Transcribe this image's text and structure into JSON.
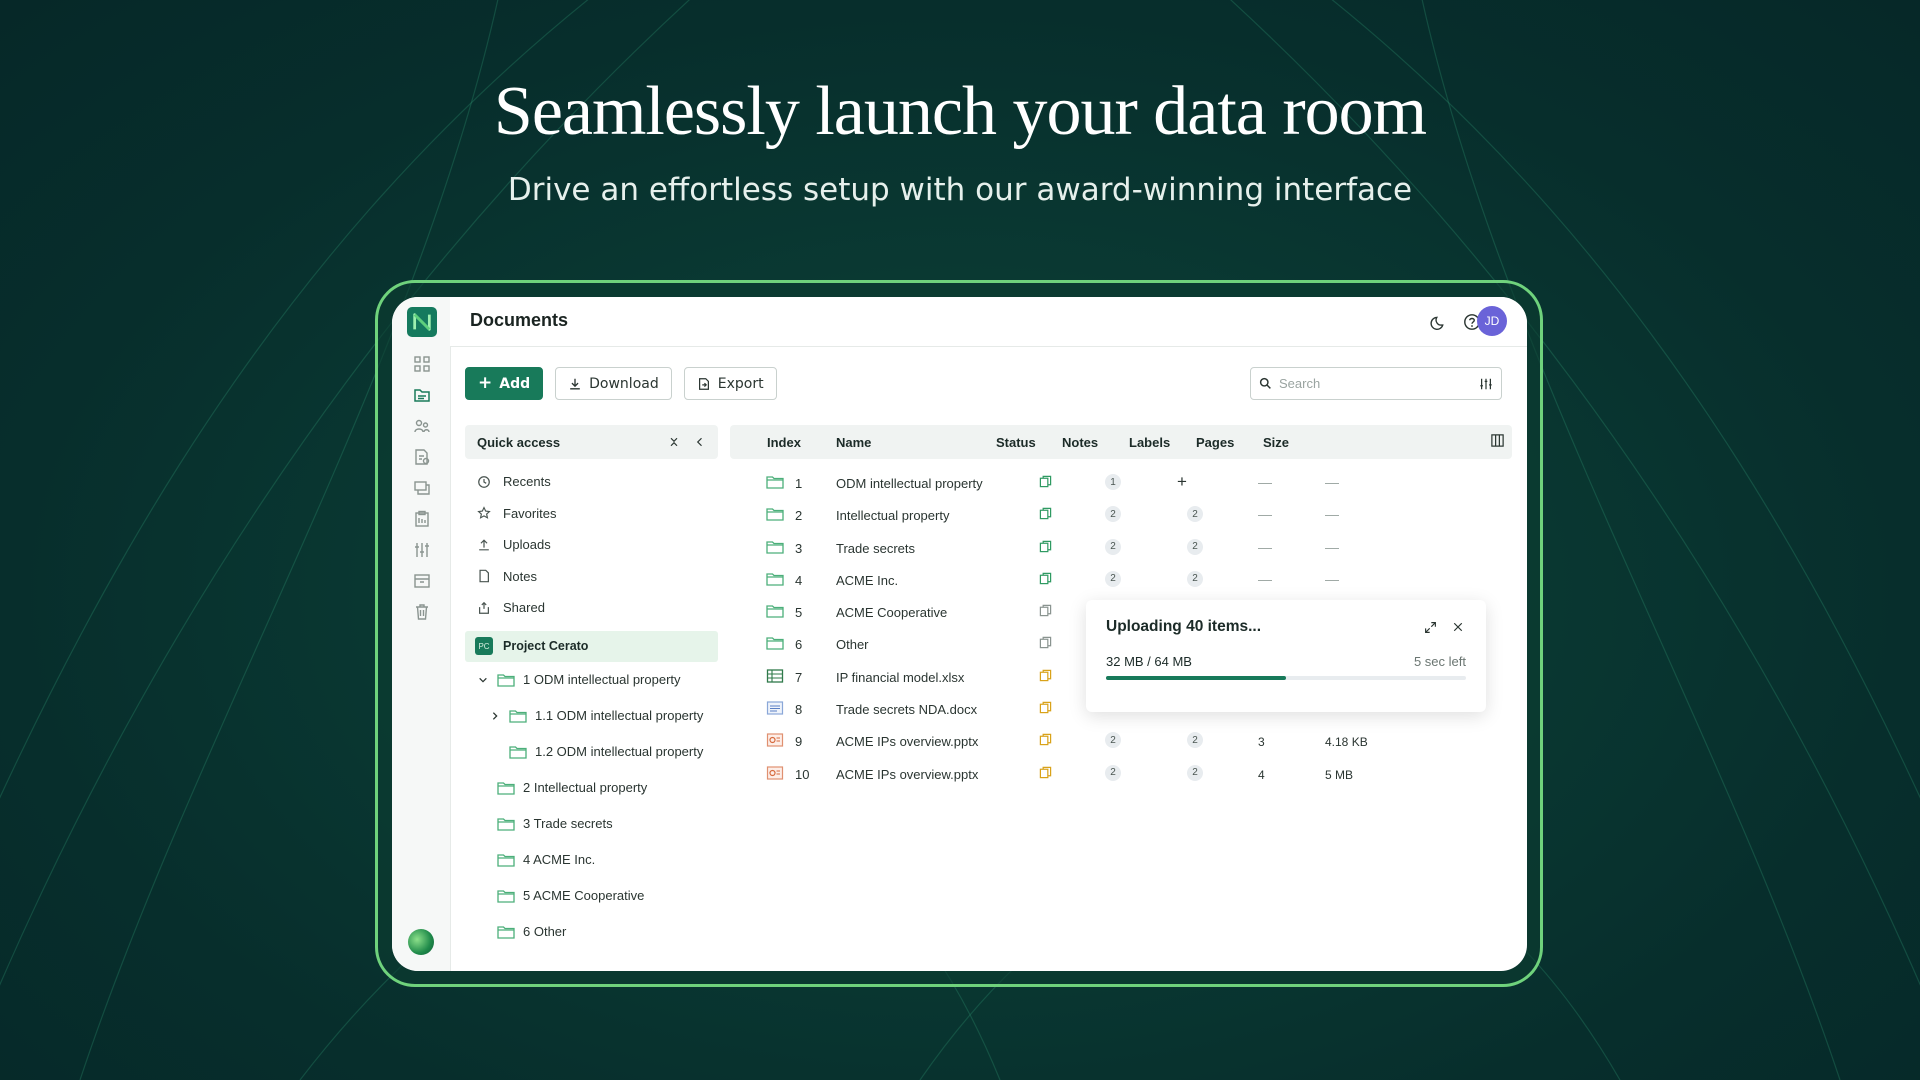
{
  "hero": {
    "title": "Seamlessly launch your data room",
    "subtitle": "Drive an effortless setup with our award-winning interface"
  },
  "header": {
    "title": "Documents",
    "avatar_initials": "JD"
  },
  "toolbar": {
    "add_label": "Add",
    "download_label": "Download",
    "export_label": "Export"
  },
  "search": {
    "placeholder": "Search"
  },
  "quick_access": {
    "title": "Quick access",
    "items": [
      {
        "label": "Recents",
        "icon": "clock-icon"
      },
      {
        "label": "Favorites",
        "icon": "star-icon"
      },
      {
        "label": "Uploads",
        "icon": "upload-icon"
      },
      {
        "label": "Notes",
        "icon": "note-icon"
      },
      {
        "label": "Shared",
        "icon": "share-icon"
      }
    ]
  },
  "project": {
    "badge": "PC",
    "name": "Project Cerato"
  },
  "tree": [
    {
      "label": "1  ODM intellectual property",
      "expanded": true
    },
    {
      "label": "1.1  ODM intellectual property",
      "expanded": false
    },
    {
      "label": "1.2  ODM intellectual property"
    },
    {
      "label": "2  Intellectual property"
    },
    {
      "label": "3  Trade secrets"
    },
    {
      "label": "4  ACME Inc."
    },
    {
      "label": "5  ACME Cooperative"
    },
    {
      "label": "6  Other"
    }
  ],
  "table": {
    "columns": [
      "Index",
      "Name",
      "Status",
      "Notes",
      "Labels",
      "Pages",
      "Size"
    ],
    "rows": [
      {
        "icon": "folder",
        "index": "1",
        "name": "ODM intellectual property",
        "status": "green",
        "notes": "1",
        "labels": "+",
        "pages": "—",
        "size": "—"
      },
      {
        "icon": "folder",
        "index": "2",
        "name": "Intellectual property",
        "status": "green",
        "notes": "2",
        "labels": "2",
        "pages": "—",
        "size": "—"
      },
      {
        "icon": "folder",
        "index": "3",
        "name": "Trade secrets",
        "status": "green",
        "notes": "2",
        "labels": "2",
        "pages": "—",
        "size": "—"
      },
      {
        "icon": "folder",
        "index": "4",
        "name": "ACME Inc.",
        "status": "green",
        "notes": "2",
        "labels": "2",
        "pages": "—",
        "size": "—"
      },
      {
        "icon": "folder",
        "index": "5",
        "name": "ACME Cooperative",
        "status": "gray",
        "notes": "",
        "labels": "",
        "pages": "",
        "size": ""
      },
      {
        "icon": "folder",
        "index": "6",
        "name": "Other",
        "status": "gray",
        "notes": "",
        "labels": "",
        "pages": "",
        "size": ""
      },
      {
        "icon": "sheet",
        "index": "7",
        "name": "IP financial model.xlsx",
        "status": "yellow",
        "notes": "",
        "labels": "",
        "pages": "",
        "size": ""
      },
      {
        "icon": "doc",
        "index": "8",
        "name": "Trade secrets NDA.docx",
        "status": "yellow",
        "notes": "",
        "labels": "",
        "pages": "",
        "size": ""
      },
      {
        "icon": "ppt",
        "index": "9",
        "name": "ACME IPs overview.pptx",
        "status": "yellow",
        "notes": "2",
        "labels": "2",
        "pages": "3",
        "size": "4.18 KB"
      },
      {
        "icon": "ppt",
        "index": "10",
        "name": "ACME IPs overview.pptx",
        "status": "yellow",
        "notes": "2",
        "labels": "2",
        "pages": "4",
        "size": "5 MB"
      }
    ]
  },
  "upload": {
    "title": "Uploading 40 items...",
    "progress_text": "32 MB / 64 MB",
    "time_left": "5 sec left",
    "progress": 0.5
  },
  "colors": {
    "accent": "#187a5a",
    "status_green": "#2f9a62",
    "status_yellow": "#d9a21a",
    "status_gray": "#8a9490"
  }
}
